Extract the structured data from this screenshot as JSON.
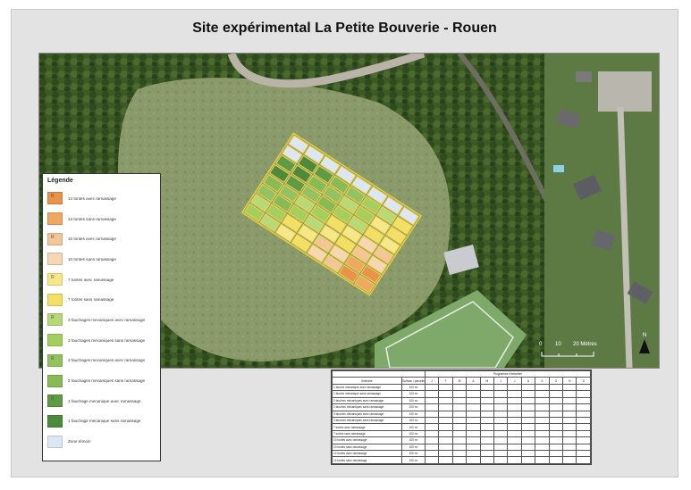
{
  "title": "Site expérimental La Petite Bouverie - Rouen",
  "legend": {
    "title": "Légende",
    "items": [
      {
        "label": "14 tontes avec ramassage",
        "color": "#e9924a",
        "marked": true
      },
      {
        "label": "14 tontes sans ramassage",
        "color": "#efa862",
        "marked": false
      },
      {
        "label": "10 tontes avec ramassage",
        "color": "#f3c698",
        "marked": true
      },
      {
        "label": "10 tontes sans ramassage",
        "color": "#f6d7b3",
        "marked": false
      },
      {
        "label": "7 tontes avec ramassage",
        "color": "#f6e78a",
        "marked": true
      },
      {
        "label": "7 tontes sans ramassage",
        "color": "#f2df66",
        "marked": false
      },
      {
        "label": "3 fauchages mecaniques avec ramassage",
        "color": "#b7d978",
        "marked": true
      },
      {
        "label": "3 fauchages mecaniques sans ramassage",
        "color": "#a4cf5e",
        "marked": false
      },
      {
        "label": "2 fauchages mecaniques avec ramassage",
        "color": "#94c261",
        "marked": true
      },
      {
        "label": "2 fauchages mecaniques sans ramassage",
        "color": "#88bb56",
        "marked": false
      },
      {
        "label": "1 fauchage mecanique avec ramassage",
        "color": "#5f9a45",
        "marked": true
      },
      {
        "label": "1 fauchage mecanique sans ramassage",
        "color": "#4d8a3c",
        "marked": false
      },
      {
        "label": "Zone témoin",
        "color": "#dde6f3",
        "marked": false
      }
    ],
    "mark_symbol": "R"
  },
  "scale": {
    "labels": [
      "0",
      "10",
      "20 Mètres"
    ]
  },
  "north": {
    "label": "N"
  },
  "schedule": {
    "title": "Programme d'entretien",
    "header_treatment": "Itinéraire",
    "header_area": "Surface / parcelle",
    "months": [
      "J",
      "F",
      "M",
      "A",
      "M",
      "J",
      "J",
      "A",
      "S",
      "O",
      "N",
      "D"
    ],
    "rows": [
      {
        "label": "1 fauche mécanique avec ramassage",
        "area": "100 m²"
      },
      {
        "label": "1 fauche mécanique sans ramassage",
        "area": "100 m²"
      },
      {
        "label": "2 fauches mécaniques avec ramassage",
        "area": "100 m²"
      },
      {
        "label": "2 fauches mécaniques sans ramassage",
        "area": "100 m²"
      },
      {
        "label": "3 fauches mécaniques avec ramassage",
        "area": "100 m²"
      },
      {
        "label": "3 fauches mécaniques sans ramassage",
        "area": "100 m²"
      },
      {
        "label": "7 tontes avec ramassage",
        "area": "100 m²"
      },
      {
        "label": "7 tontes sans ramassage",
        "area": "100 m²"
      },
      {
        "label": "10 tontes avec ramassage",
        "area": "100 m²"
      },
      {
        "label": "10 tontes sans ramassage",
        "area": "100 m²"
      },
      {
        "label": "14 tontes avec ramassage",
        "area": "100 m²"
      },
      {
        "label": "14 tontes sans ramassage",
        "area": "100 m²"
      }
    ]
  }
}
